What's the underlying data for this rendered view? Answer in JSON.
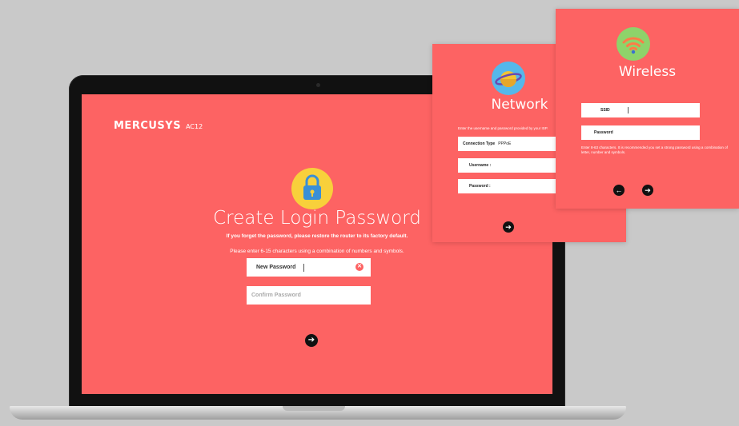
{
  "laptop": {
    "brand": "MERCUSYS",
    "model": "AC12",
    "title": "Create Login Password",
    "warning": "If you forget the password, please restore the router to its factory default.",
    "hint": "Please enter 6-15 characters using a combination of numbers and symbols.",
    "new_password_label": "New Password",
    "confirm_password_placeholder": "Confirm Password",
    "next_icon": "arrow-right-icon",
    "lock_icon": "lock-icon"
  },
  "network_panel": {
    "title": "Network",
    "hint": "Enter the username and password provided by your ISP.",
    "connection_type_label": "Connection Type",
    "connection_type_value": "PPPoE",
    "username_label": "Username :",
    "password_label": "Password :",
    "icon": "globe-icon",
    "next_icon": "arrow-right-icon"
  },
  "wireless_panel": {
    "title": "Wireless",
    "ssid_label": "SSID",
    "password_label": "Password",
    "hint": "Enter 8-63 characters. It is recommended you set a strong password using a combination of letter, number and symbols.",
    "icon": "wifi-icon",
    "prev_icon": "arrow-left-icon",
    "next_icon": "arrow-right-icon"
  },
  "colors": {
    "accent": "#fd6363",
    "lock_badge": "#f8d03b",
    "globe_badge": "#55b8ea",
    "wifi_badge": "#8ed36a",
    "background": "#c9c9c9"
  }
}
